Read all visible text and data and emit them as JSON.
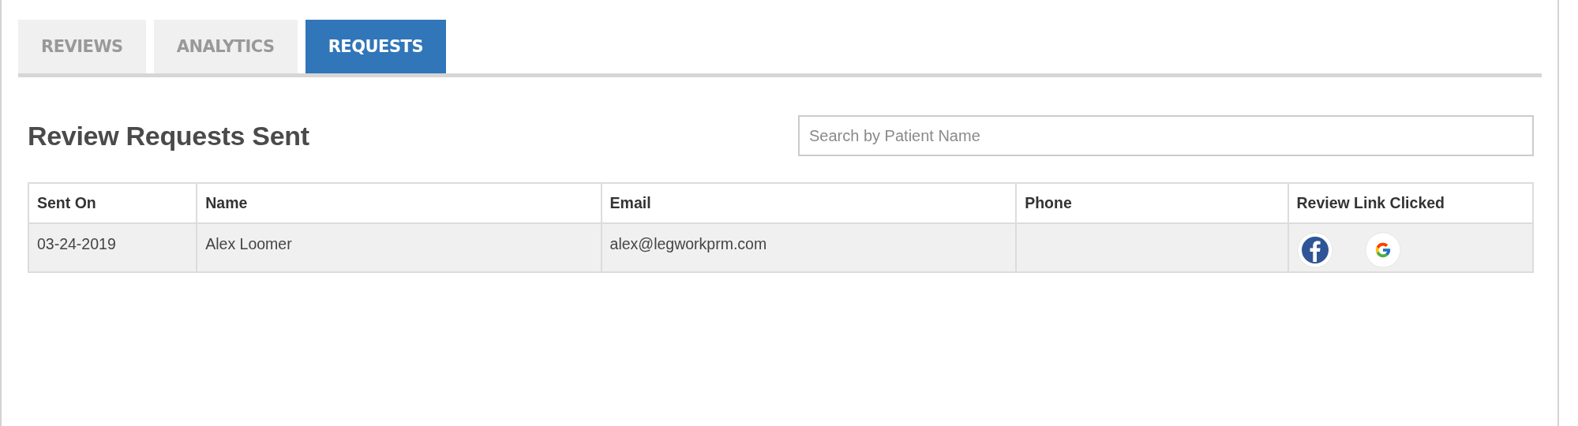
{
  "tabs": [
    {
      "label": "REVIEWS",
      "selected": false
    },
    {
      "label": "ANALYTICS",
      "selected": false
    },
    {
      "label": "REQUESTS",
      "selected": true
    }
  ],
  "heading": "Review Requests Sent",
  "search": {
    "placeholder": "Search by Patient Name"
  },
  "table": {
    "columns": [
      "Sent On",
      "Name",
      "Email",
      "Phone",
      "Review Link Clicked"
    ],
    "rows": [
      {
        "sent_on": "03-24-2019",
        "name": "Alex Loomer",
        "email": "alex@legworkprm.com",
        "review_links": [
          {
            "kind": "facebook"
          },
          {
            "kind": "google"
          }
        ]
      }
    ]
  }
}
